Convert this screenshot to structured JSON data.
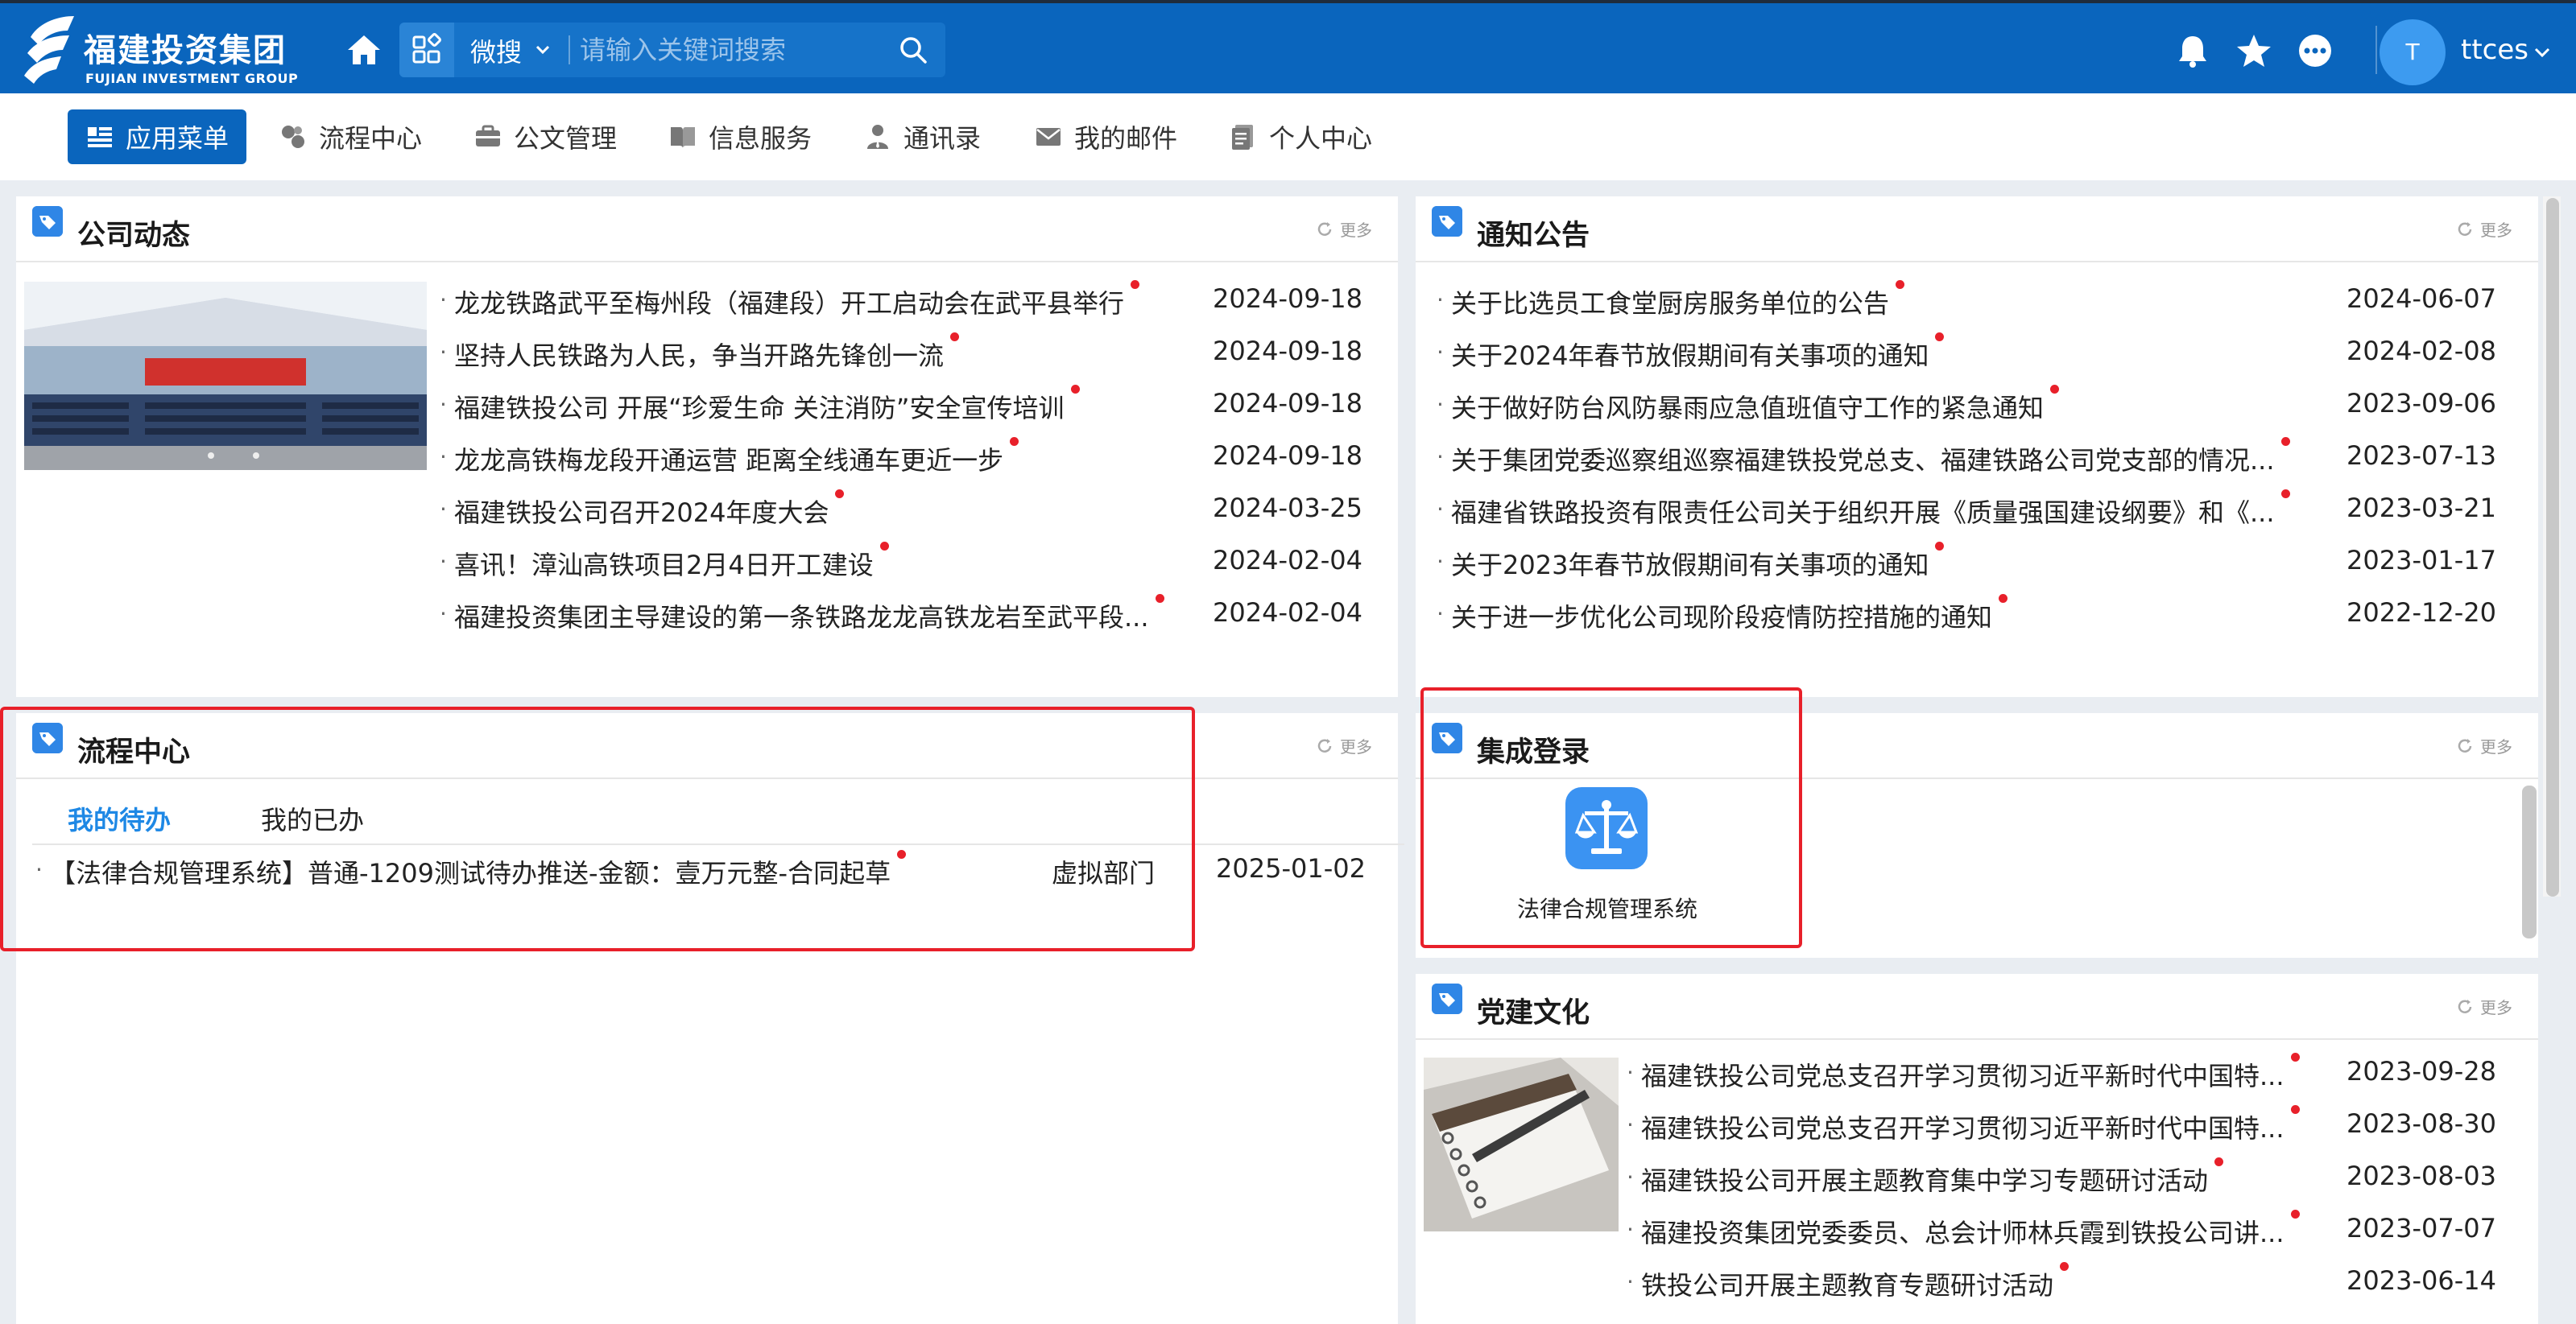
{
  "header": {
    "logo_cn": "福建投资集团",
    "logo_en": "FUJIAN INVESTMENT GROUP",
    "search_scope": "微搜",
    "search_placeholder": "请输入关键词搜索",
    "avatar_initial": "T",
    "username": "ttces"
  },
  "nav": {
    "items": [
      {
        "label": "应用菜单",
        "icon": "app-menu-icon",
        "active": true
      },
      {
        "label": "流程中心",
        "icon": "workflow-icon"
      },
      {
        "label": "公文管理",
        "icon": "briefcase-icon"
      },
      {
        "label": "信息服务",
        "icon": "book-icon"
      },
      {
        "label": "通讯录",
        "icon": "contacts-icon"
      },
      {
        "label": "我的邮件",
        "icon": "mail-icon"
      },
      {
        "label": "个人中心",
        "icon": "profile-icon"
      }
    ]
  },
  "more_label": "更多",
  "company_news": {
    "title": "公司动态",
    "items": [
      {
        "title": "龙龙铁路武平至梅州段（福建段）开工启动会在武平县举行",
        "date": "2024-09-18"
      },
      {
        "title": "坚持人民铁路为人民，争当开路先锋创一流",
        "date": "2024-09-18"
      },
      {
        "title": "福建铁投公司 开展“珍爱生命 关注消防”安全宣传培训",
        "date": "2024-09-18"
      },
      {
        "title": "龙龙高铁梅龙段开通运营 距离全线通车更近一步",
        "date": "2024-09-18"
      },
      {
        "title": "福建铁投公司召开2024年度大会",
        "date": "2024-03-25"
      },
      {
        "title": "喜讯！漳汕高铁项目2月4日开工建设",
        "date": "2024-02-04"
      },
      {
        "title": "福建投资集团主导建设的第一条铁路龙龙高铁龙岩至武平段...",
        "date": "2024-02-04"
      }
    ]
  },
  "notices": {
    "title": "通知公告",
    "items": [
      {
        "title": "关于比选员工食堂厨房服务单位的公告",
        "date": "2024-06-07"
      },
      {
        "title": "关于2024年春节放假期间有关事项的通知",
        "date": "2024-02-08"
      },
      {
        "title": "关于做好防台风防暴雨应急值班值守工作的紧急通知",
        "date": "2023-09-06"
      },
      {
        "title": "关于集团党委巡察组巡察福建铁投党总支、福建铁路公司党支部的情况...",
        "date": "2023-07-13"
      },
      {
        "title": "福建省铁路投资有限责任公司关于组织开展《质量强国建设纲要》和《...",
        "date": "2023-03-21"
      },
      {
        "title": "关于2023年春节放假期间有关事项的通知",
        "date": "2023-01-17"
      },
      {
        "title": "关于进一步优化公司现阶段疫情防控措施的通知",
        "date": "2022-12-20"
      }
    ]
  },
  "workflow": {
    "title": "流程中心",
    "tabs": [
      "我的待办",
      "我的已办"
    ],
    "items": [
      {
        "title": "【法律合规管理系统】普通-1209测试待办推送-金额：壹万元整-合同起草",
        "dept": "虚拟部门",
        "date": "2025-01-02"
      }
    ]
  },
  "sso": {
    "title": "集成登录",
    "apps": [
      {
        "label": "法律合规管理系统",
        "icon": "scales-icon"
      }
    ]
  },
  "party": {
    "title": "党建文化",
    "items": [
      {
        "title": "福建铁投公司党总支召开学习贯彻习近平新时代中国特...",
        "date": "2023-09-28"
      },
      {
        "title": "福建铁投公司党总支召开学习贯彻习近平新时代中国特...",
        "date": "2023-08-30"
      },
      {
        "title": "福建铁投公司开展主题教育集中学习专题研讨活动",
        "date": "2023-08-03"
      },
      {
        "title": "福建投资集团党委委员、总会计师林兵霞到铁投公司讲...",
        "date": "2023-07-07"
      },
      {
        "title": "铁投公司开展主题教育专题研讨活动",
        "date": "2023-06-14"
      }
    ]
  },
  "colors": {
    "brand_blue": "#0a65bd",
    "accent_blue": "#2f86e6",
    "new_dot": "#e8202a",
    "highlight_box": "#e8202a"
  }
}
